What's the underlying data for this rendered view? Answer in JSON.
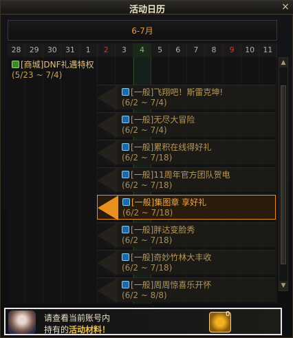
{
  "window": {
    "title": "活动日历",
    "close_label": "×"
  },
  "month": "6-7月",
  "dates": [
    {
      "label": "28",
      "style": "normal"
    },
    {
      "label": "29",
      "style": "normal"
    },
    {
      "label": "30",
      "style": "normal"
    },
    {
      "label": "31",
      "style": "normal"
    },
    {
      "label": "1",
      "style": "normal"
    },
    {
      "label": "2",
      "style": "red"
    },
    {
      "label": "3",
      "style": "normal"
    },
    {
      "label": "4",
      "style": "green"
    },
    {
      "label": "5",
      "style": "normal"
    },
    {
      "label": "6",
      "style": "normal"
    },
    {
      "label": "7",
      "style": "normal"
    },
    {
      "label": "8",
      "style": "normal"
    },
    {
      "label": "9",
      "style": "red"
    },
    {
      "label": "10",
      "style": "normal"
    },
    {
      "label": "11",
      "style": "normal"
    }
  ],
  "events": [
    {
      "name": "[商城]DNF礼遇特权",
      "range": "(5/23 ~ 7/4)",
      "icon": "mall-icon"
    },
    {
      "name": "[一般]飞翔吧！斯雷克坤!",
      "range": "(6/2 ~ 7/4)",
      "icon": "event-icon"
    },
    {
      "name": "[一般]无尽大冒险",
      "range": "(6/2 ~ 7/4)",
      "icon": "event-icon"
    },
    {
      "name": "[一般]累积在线得好礼",
      "range": "(6/2 ~ 7/18)",
      "icon": "event-icon"
    },
    {
      "name": "[一般]11周年官方团队贺电",
      "range": "(6/2 ~ 7/18)",
      "icon": "event-icon"
    },
    {
      "name": "[一般]集图章 享好礼",
      "range": "(6/2 ~ 7/18)",
      "icon": "event-icon",
      "active": true
    },
    {
      "name": "[一般]胖达变脸秀",
      "range": "(6/2 ~ 7/18)",
      "icon": "event-icon"
    },
    {
      "name": "[一般]奇妙竹林大丰收",
      "range": "(6/2 ~ 7/18)",
      "icon": "event-icon"
    },
    {
      "name": "[一般]周周惊喜乐开怀",
      "range": "(6/2 ~ 8/8)",
      "icon": "event-icon"
    }
  ],
  "footer": {
    "line1": "请查看当前账号内",
    "line2_prefix": "持有的",
    "line2_highlight": "活动材料！",
    "coin_count": "0"
  },
  "colors": {
    "accent": "#e89020",
    "today": "#5fd04a",
    "weekend": "#d03a2a"
  }
}
